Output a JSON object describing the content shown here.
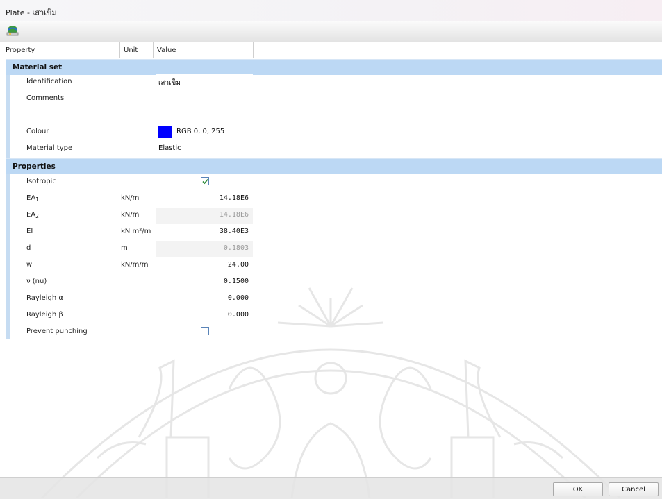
{
  "window": {
    "title": "Plate - เสาเข็ม"
  },
  "toolbar": {
    "icon": "material-set-icon"
  },
  "columns": {
    "property": "Property",
    "unit": "Unit",
    "value": "Value"
  },
  "sections": {
    "material_set": {
      "label": "Material set",
      "identification": {
        "name": "Identification",
        "value": "เสาเข็ม"
      },
      "comments": {
        "name": "Comments",
        "value": ""
      },
      "colour": {
        "name": "Colour",
        "value": "RGB 0, 0, 255",
        "swatch": "#0000ff"
      },
      "material_type": {
        "name": "Material type",
        "value": "Elastic"
      }
    },
    "properties": {
      "label": "Properties",
      "isotropic": {
        "name": "Isotropic",
        "checked": true
      },
      "ea1": {
        "name": "EA",
        "sub": "1",
        "unit": "kN/m",
        "value": "14.18E6"
      },
      "ea2": {
        "name": "EA",
        "sub": "2",
        "unit": "kN/m",
        "value": "14.18E6"
      },
      "ei": {
        "name": "EI",
        "unit": "kN m²/m",
        "value": "38.40E3"
      },
      "d": {
        "name": "d",
        "unit": "m",
        "value": "0.1803"
      },
      "w": {
        "name": "w",
        "unit": "kN/m/m",
        "value": "24.00"
      },
      "nu": {
        "name": "ν (nu)",
        "value": "0.1500"
      },
      "rayleigh_alpha": {
        "name": "Rayleigh α",
        "value": "0.000"
      },
      "rayleigh_beta": {
        "name": "Rayleigh β",
        "value": "0.000"
      },
      "prevent_punching": {
        "name": "Prevent punching",
        "checked": false
      }
    }
  },
  "buttons": {
    "ok": "OK",
    "cancel": "Cancel"
  },
  "colors": {
    "section_bg": "#bcd8f4",
    "left_bar": "#c6dcf2",
    "check": "#2e8b3a",
    "watermark": "#e6e6e6"
  }
}
